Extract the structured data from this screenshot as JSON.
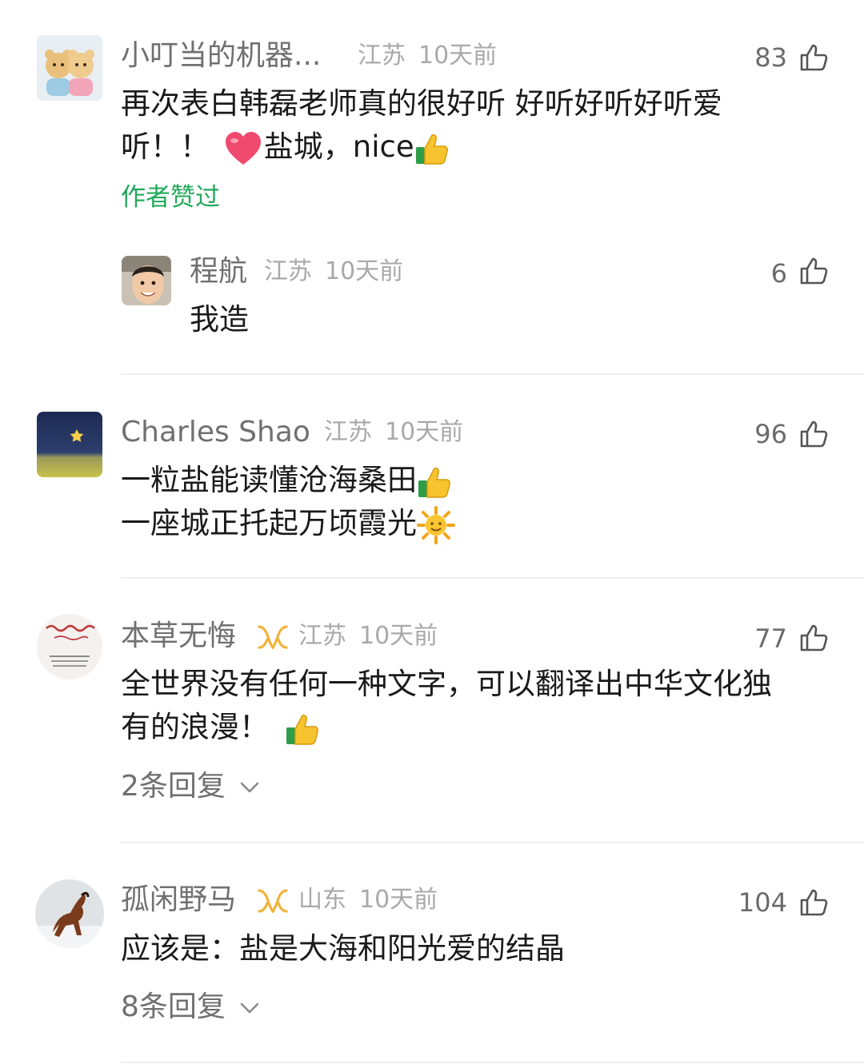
{
  "comments": [
    {
      "name": "小叮当的机器...",
      "location": "江苏",
      "time": "10天前",
      "likes": "83",
      "line1": "再次表白韩磊老师真的很好听 好听好听好听爱",
      "line2a": "听！！",
      "line2b": "盐城，nice",
      "liked_by_author": "作者赞过",
      "reply": {
        "name": "程航",
        "location": "江苏",
        "time": "10天前",
        "likes": "6",
        "text": "我造"
      }
    },
    {
      "name": "Charles Shao",
      "location": "江苏",
      "time": "10天前",
      "likes": "96",
      "line1": "一粒盐能读懂沧海桑田",
      "line2": "一座城正托起万顷霞光"
    },
    {
      "name": "本草无悔",
      "location": "江苏",
      "time": "10天前",
      "likes": "77",
      "line1": "全世界没有任何一种文字，可以翻译出中华文化独",
      "line2": "有的浪漫！",
      "replies": "2条回复"
    },
    {
      "name": "孤闲野马",
      "location": "山东",
      "time": "10天前",
      "likes": "104",
      "line1": "应该是：盐是大海和阳光爱的结晶",
      "replies": "8条回复"
    }
  ],
  "icons": {
    "like": "thumb-up-outline-icon",
    "badge": "gold-badge-icon",
    "chevron": "chevron-down-icon",
    "emoji_heart": "heart-emoji",
    "emoji_thumb": "thumbs-up-emoji",
    "emoji_sun": "sun-emoji"
  },
  "colors": {
    "accent_green": "#20a85a",
    "badge_gold": "#f0b43a"
  }
}
